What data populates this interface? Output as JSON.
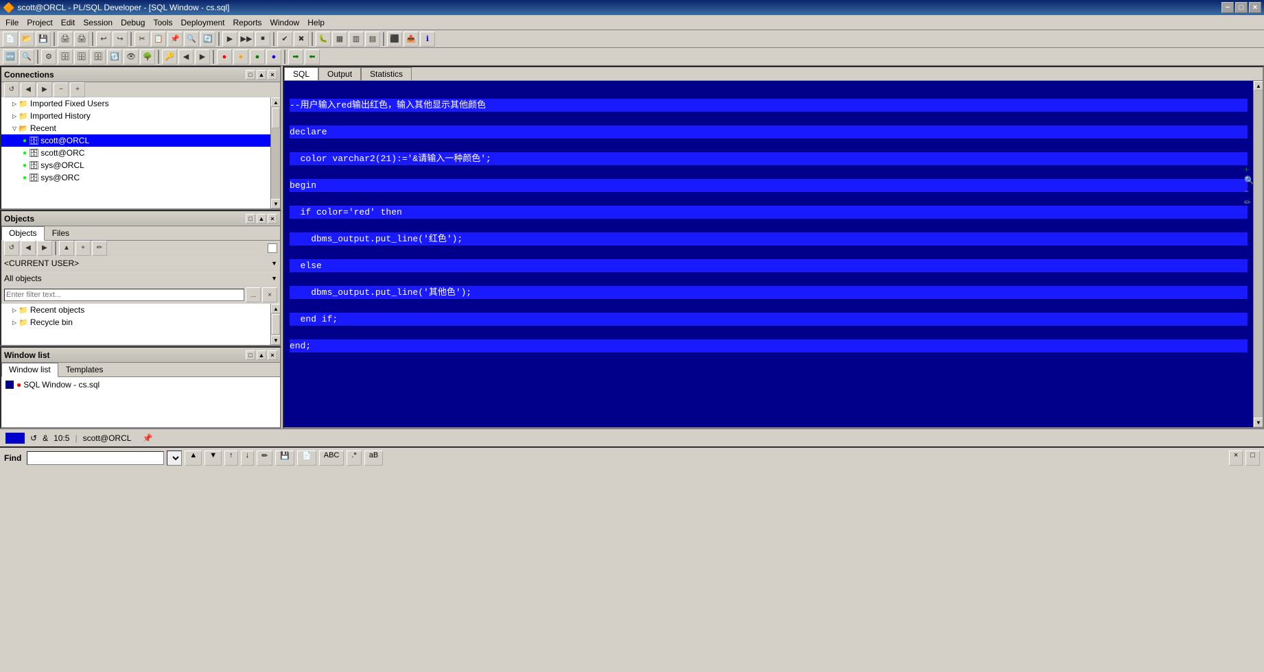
{
  "titleBar": {
    "title": "scott@ORCL - PL/SQL Developer - [SQL Window - cs.sql]",
    "minimize": "−",
    "maximize": "□",
    "close": "×"
  },
  "menuBar": {
    "items": [
      "File",
      "Project",
      "Edit",
      "Session",
      "Debug",
      "Tools",
      "Deployment",
      "Reports",
      "Window",
      "Help"
    ]
  },
  "connections": {
    "title": "Connections",
    "nodes": [
      {
        "label": "Imported Fixed Users",
        "indent": 1,
        "type": "folder"
      },
      {
        "label": "Imported History",
        "indent": 1,
        "type": "folder"
      },
      {
        "label": "Recent",
        "indent": 1,
        "type": "folder",
        "expanded": true
      },
      {
        "label": "scott@ORCL",
        "indent": 2,
        "type": "db",
        "selected": true
      },
      {
        "label": "scott@ORC",
        "indent": 2,
        "type": "db"
      },
      {
        "label": "sys@ORCL",
        "indent": 2,
        "type": "db"
      },
      {
        "label": "sys@ORC",
        "indent": 2,
        "type": "db"
      }
    ]
  },
  "objects": {
    "title": "Objects",
    "tabs": [
      "Objects",
      "Files"
    ],
    "activeTab": "Objects",
    "currentUser": "<CURRENT USER>",
    "allObjects": "All objects",
    "filterPlaceholder": "Enter filter text...",
    "treeItems": [
      {
        "label": "Recent objects",
        "indent": 1,
        "type": "folder"
      },
      {
        "label": "Recycle bin",
        "indent": 1,
        "type": "folder"
      }
    ]
  },
  "windowList": {
    "title": "Window list",
    "tabs": [
      "Window list",
      "Templates"
    ],
    "activeTab": "Window list",
    "items": [
      {
        "label": "SQL Window - cs.sql"
      }
    ]
  },
  "editor": {
    "tabs": [
      "SQL",
      "Output",
      "Statistics"
    ],
    "activeTab": "SQL",
    "code": "--用户输入red输出红色，输入其他显示其他颜色\ndeclare\n  color varchar2(21):='&请输入一种颜色';\nbegin\n  if color='red' then\n    dbms_output.put_line('红色');\n  else\n    dbms_output.put_line('其他色');\n  end if;\nend;",
    "highlightedLines": [
      0,
      1,
      2,
      3,
      4,
      5,
      6,
      7,
      8,
      9
    ]
  },
  "statusBar": {
    "position": "10:5",
    "ampersand": "&",
    "connection": "scott@ORCL"
  },
  "findBar": {
    "label": "Find",
    "placeholder": ""
  }
}
